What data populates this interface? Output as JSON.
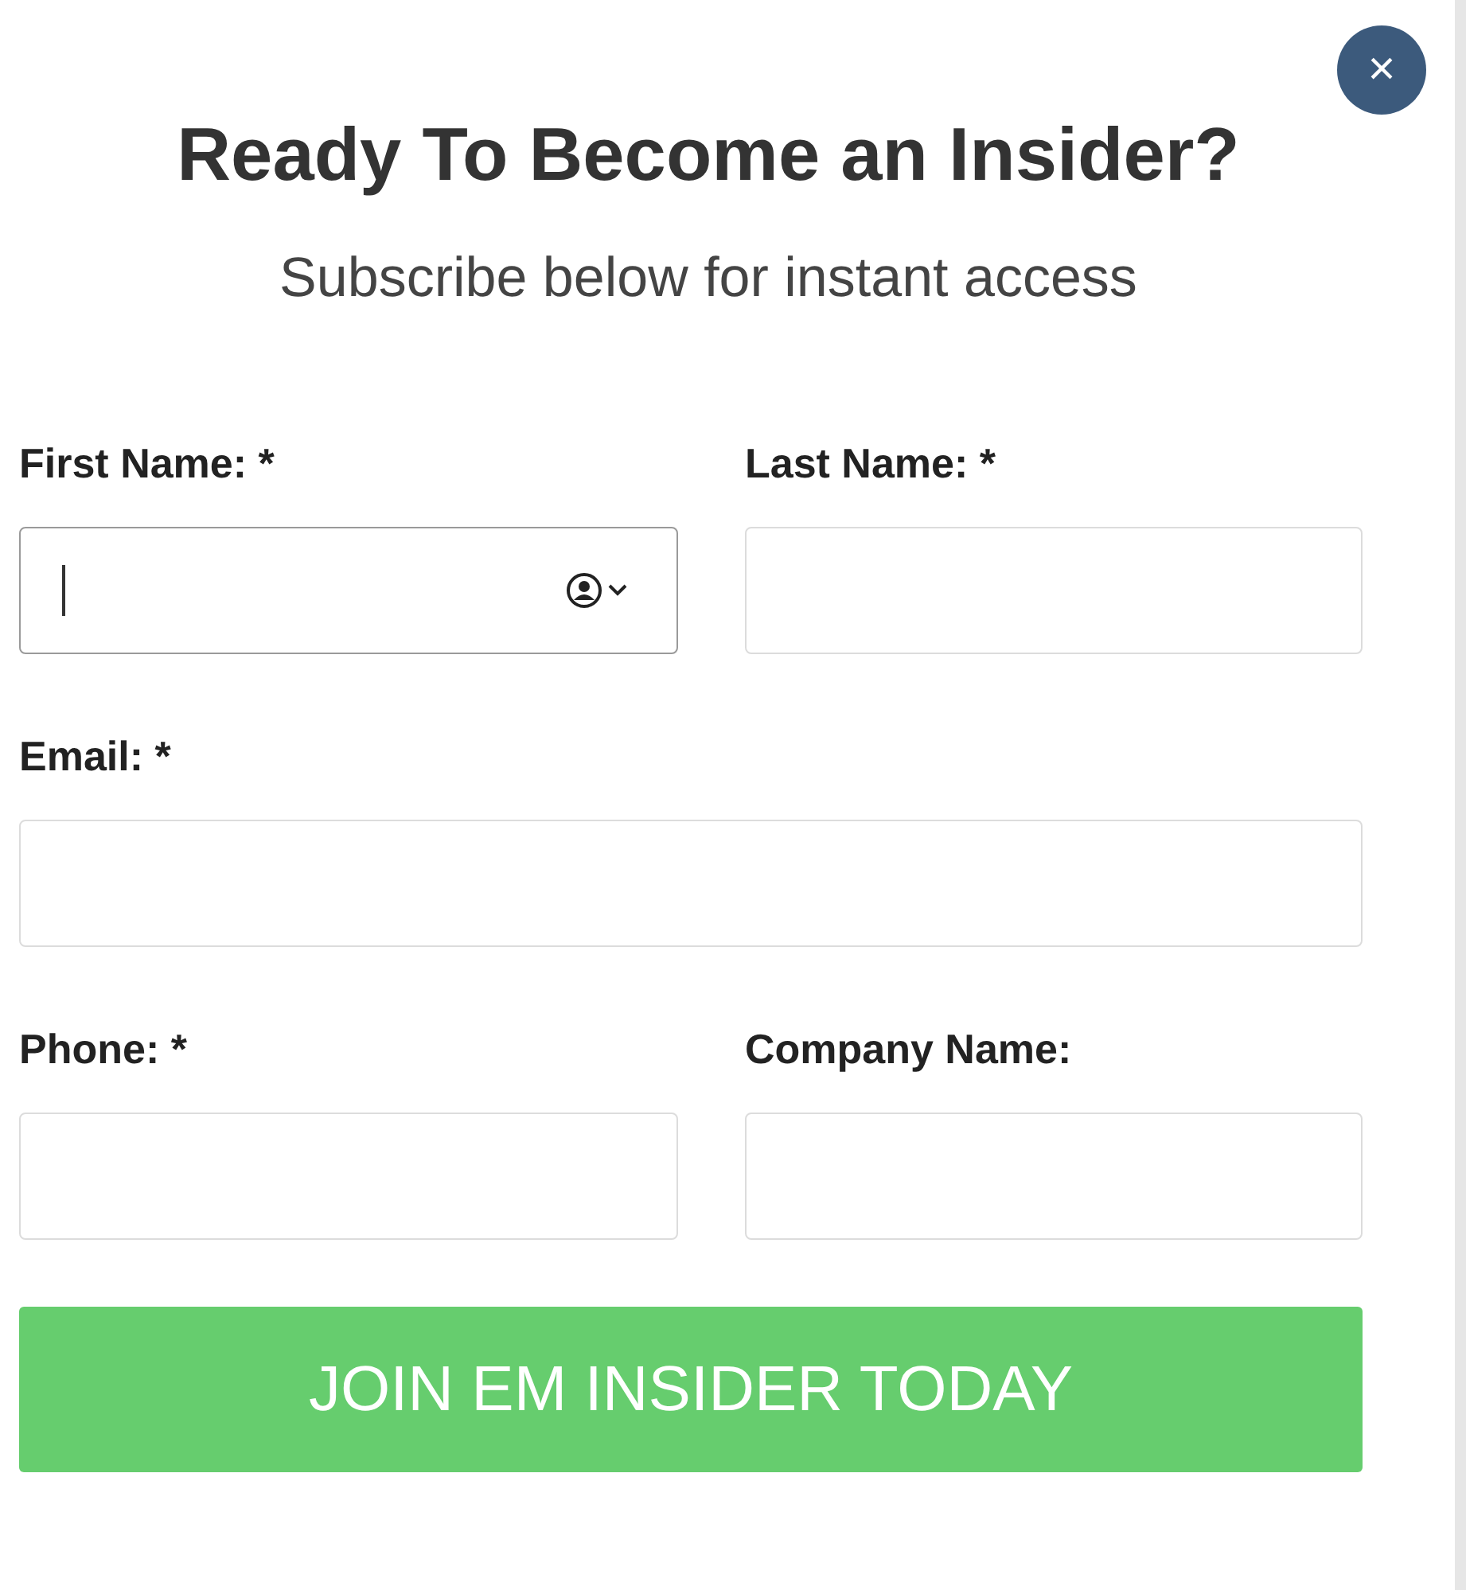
{
  "close_button": {
    "label": "×"
  },
  "title": "Ready To Become an Insider?",
  "subtitle": "Subscribe below for instant access",
  "fields": [
    {
      "label": "First Name: *",
      "kind": "half",
      "focused": true
    },
    {
      "label": "Last Name: *",
      "kind": "half",
      "focused": false
    },
    {
      "label": "Email: *",
      "kind": "full",
      "focused": false
    },
    {
      "label": "Phone: *",
      "kind": "half",
      "focused": false
    },
    {
      "label": "Company Name:",
      "kind": "half",
      "focused": false
    }
  ],
  "submit_button": {
    "label": "JOIN EM INSIDER TODAY"
  }
}
